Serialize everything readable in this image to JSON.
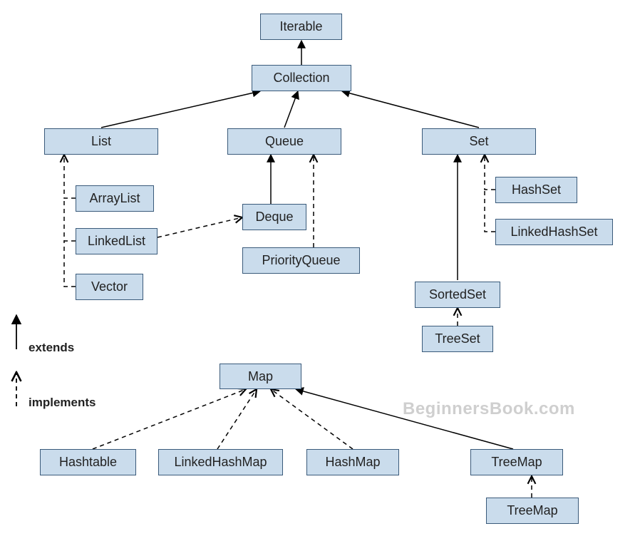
{
  "nodes": {
    "iterable": "Iterable",
    "collection": "Collection",
    "list": "List",
    "queue": "Queue",
    "set": "Set",
    "arraylist": "ArrayList",
    "linkedlist": "LinkedList",
    "vector": "Vector",
    "deque": "Deque",
    "priorityqueue": "PriorityQueue",
    "hashset": "HashSet",
    "linkedhashset": "LinkedHashSet",
    "sortedset": "SortedSet",
    "treeset": "TreeSet",
    "map": "Map",
    "hashtable": "Hashtable",
    "linkedhashmap": "LinkedHashMap",
    "hashmap": "HashMap",
    "treemap": "TreeMap",
    "treemap2": "TreeMap"
  },
  "legend": {
    "extends": "extends",
    "implements": "implements"
  },
  "watermark": "BeginnersBook.com",
  "relations": [
    {
      "from": "collection",
      "to": "iterable",
      "type": "extends"
    },
    {
      "from": "list",
      "to": "collection",
      "type": "extends"
    },
    {
      "from": "queue",
      "to": "collection",
      "type": "extends"
    },
    {
      "from": "set",
      "to": "collection",
      "type": "extends"
    },
    {
      "from": "arraylist",
      "to": "list",
      "type": "implements"
    },
    {
      "from": "linkedlist",
      "to": "list",
      "type": "implements"
    },
    {
      "from": "vector",
      "to": "list",
      "type": "implements"
    },
    {
      "from": "deque",
      "to": "queue",
      "type": "extends"
    },
    {
      "from": "priorityqueue",
      "to": "queue",
      "type": "implements"
    },
    {
      "from": "linkedlist",
      "to": "deque",
      "type": "implements"
    },
    {
      "from": "hashset",
      "to": "set",
      "type": "implements"
    },
    {
      "from": "linkedhashset",
      "to": "set",
      "type": "implements"
    },
    {
      "from": "sortedset",
      "to": "set",
      "type": "extends"
    },
    {
      "from": "treeset",
      "to": "sortedset",
      "type": "implements"
    },
    {
      "from": "hashtable",
      "to": "map",
      "type": "implements"
    },
    {
      "from": "linkedhashmap",
      "to": "map",
      "type": "implements"
    },
    {
      "from": "hashmap",
      "to": "map",
      "type": "implements"
    },
    {
      "from": "treemap",
      "to": "map",
      "type": "extends"
    },
    {
      "from": "treemap2",
      "to": "treemap",
      "type": "implements"
    }
  ]
}
